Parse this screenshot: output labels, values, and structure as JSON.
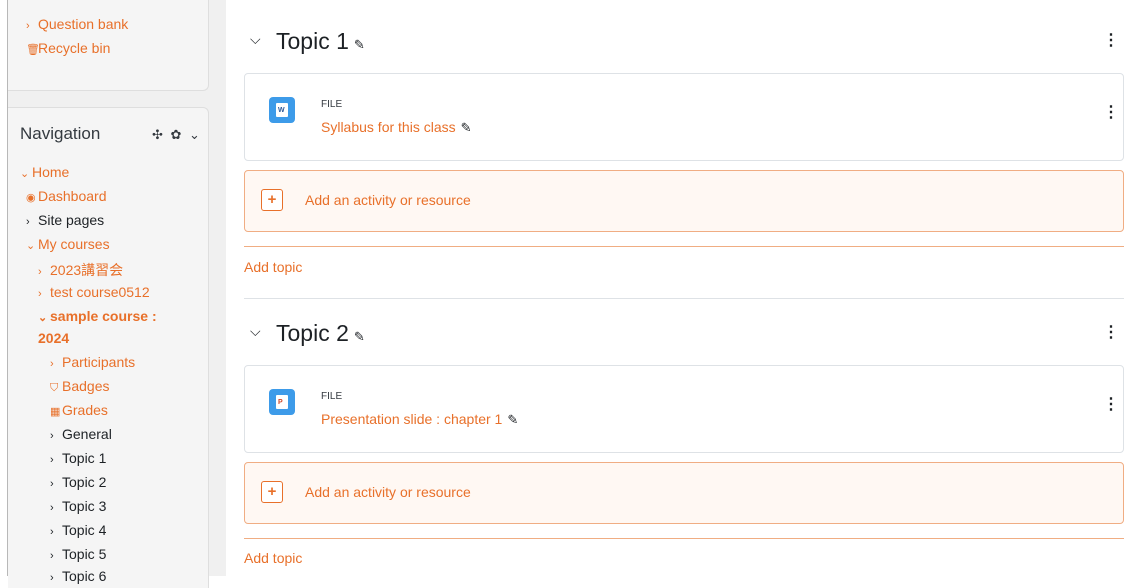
{
  "sidebar": {
    "top_items": [
      {
        "label": "Question bank"
      },
      {
        "label": "Recycle bin"
      }
    ],
    "nav_title": "Navigation",
    "nav_tools": "✣ ✿ ⌄",
    "items": [
      {
        "label": "Home"
      },
      {
        "label": "Dashboard"
      },
      {
        "label": "Site pages"
      },
      {
        "label": "My courses"
      },
      {
        "label": "2023講習会"
      },
      {
        "label": "test course0512"
      },
      {
        "label": "sample course :"
      },
      {
        "label": "2024"
      },
      {
        "label": "Participants"
      },
      {
        "label": "Badges"
      },
      {
        "label": "Grades"
      },
      {
        "label": "General"
      },
      {
        "label": "Topic 1"
      },
      {
        "label": "Topic 2"
      },
      {
        "label": "Topic 3"
      },
      {
        "label": "Topic 4"
      },
      {
        "label": "Topic 5"
      },
      {
        "label": "Topic 6"
      }
    ]
  },
  "sections": [
    {
      "title": "Topic 1",
      "activity": {
        "type": "FILE",
        "name": "Syllabus for this class",
        "icon": "word-file-icon"
      },
      "add_label": "Add an activity or resource",
      "add_topic": "Add topic"
    },
    {
      "title": "Topic 2",
      "activity": {
        "type": "FILE",
        "name": "Presentation slide : chapter 1",
        "icon": "powerpoint-file-icon"
      },
      "add_label": "Add an activity or resource",
      "add_topic": "Add topic"
    }
  ],
  "colors": {
    "accent": "#e8702a",
    "icon_bg": "#3d9be9",
    "sidebar_bg": "#f0f0f0"
  }
}
